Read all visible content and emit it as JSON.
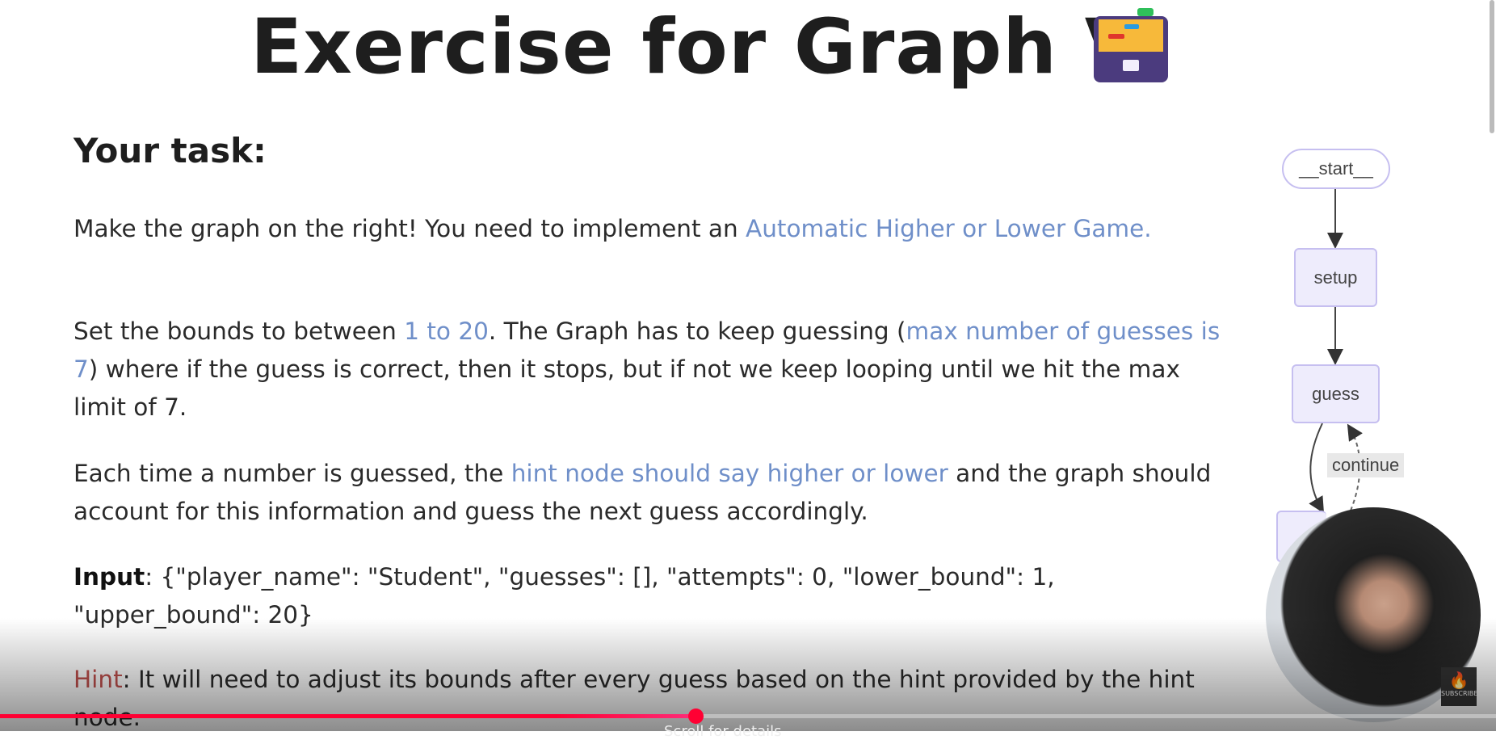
{
  "title": "Exercise for Graph V",
  "title_icon": "card-file-box-icon",
  "task_heading": "Your task:",
  "paragraphs": {
    "p1_a": "Make the graph on the right! You need to implement an ",
    "p1_hl": "Automatic Higher or Lower Game.",
    "p2_a": "Set the bounds to between ",
    "p2_hl1": "1 to 20",
    "p2_b": ". The Graph has to keep guessing (",
    "p2_hl2": "max number of guesses is 7",
    "p2_c": ") where if the guess is correct, then it stops, but if not we keep looping until we hit the max limit of 7.",
    "p3_a": "Each time a number is guessed, the ",
    "p3_hl": "hint node should say higher or lower",
    "p3_b": " and the graph should account for this information and guess the next guess accordingly.",
    "input_label": "Input",
    "input_text": ": {\"player_name\": \"Student\", \"guesses\": [], \"attempts\": 0, \"lower_bound\": 1, \"upper_bound\": 20}",
    "hint_label": "Hint",
    "hint_text": ": It will need to adjust its bounds after every guess based on the hint provided by the hint node."
  },
  "graph": {
    "nodes": [
      "__start__",
      "setup",
      "guess"
    ],
    "edge_label": "continue"
  },
  "player": {
    "progress_percent": 46.5,
    "scroll_hint": "Scroll for details",
    "subscribe_label": "SUBSCRIBE",
    "accent": "#ff0033"
  },
  "colors": {
    "highlight": "#6f8fc9",
    "hint": "#c0504d",
    "node_fill": "#eeecfc",
    "node_border": "#c6bff0"
  }
}
